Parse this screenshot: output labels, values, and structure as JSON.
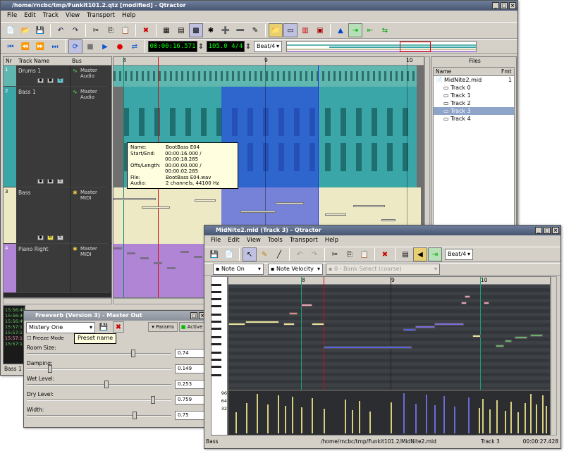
{
  "main": {
    "title": "/home/rncbc/tmp/Funkit101.2.qtz [modified] - Qtractor",
    "menu": [
      "File",
      "Edit",
      "Track",
      "View",
      "Transport",
      "Help"
    ],
    "time_display": "00:00:16.571",
    "tempo_display": "105.0 4/4",
    "snap": "Beat/4",
    "track_header": {
      "nr": "Nr",
      "name": "Track Name",
      "bus": "Bus"
    },
    "ruler": [
      "8",
      "9",
      "10"
    ],
    "tracks": [
      {
        "nr": "1",
        "name": "Drums 1",
        "bus": "Master",
        "bus_type": "Audio"
      },
      {
        "nr": "2",
        "name": "Bass 1",
        "bus": "Master",
        "bus_type": "Audio"
      },
      {
        "nr": "3",
        "name": "Bass",
        "bus": "Master",
        "bus_type": "MIDI"
      },
      {
        "nr": "4",
        "name": "Piano Right",
        "bus": "Master",
        "bus_type": "MIDI"
      }
    ],
    "clip_tooltip": [
      {
        "k": "Name:",
        "v": "BootBass E04"
      },
      {
        "k": "Start/End:",
        "v": "00:00:16.000 / 00:00:18.285"
      },
      {
        "k": "Offs/Length:",
        "v": "00:00:00.000 / 00:00:02.285"
      },
      {
        "k": "File:",
        "v": "BootBass E04.wav"
      },
      {
        "k": "Audio:",
        "v": "2 channels, 44100 Hz"
      }
    ],
    "messages": [
      "15:56:49",
      "15:56:49",
      "15:56:49",
      "15:57:11",
      "15:57:11",
      "15:57:13",
      "15:57:13"
    ],
    "status": "Bass 1",
    "files": {
      "title": "Files",
      "col_name": "Name",
      "col_fmt": "Fmt",
      "root": "MidNite2.mid",
      "root_fmt": "1",
      "items": [
        "Track 0",
        "Track 1",
        "Track 2",
        "Track 3",
        "Track 4"
      ],
      "selected": "Track 3"
    }
  },
  "freeverb": {
    "title": "Freeverb (Version 3) - Master Out",
    "preset": "Mistery One",
    "tooltip": "Preset name",
    "freeze": "Freeze Mode",
    "params_btn": "Params",
    "active_btn": "Active",
    "params": [
      {
        "label": "Room Size:",
        "value": "0.74",
        "level": 0.74
      },
      {
        "label": "Damping:",
        "value": "0.149",
        "level": 0.149
      },
      {
        "label": "Wet Level:",
        "value": "0.253",
        "level": 0.55
      },
      {
        "label": "Dry Level:",
        "value": "0.759",
        "level": 0.88
      },
      {
        "label": "Width:",
        "value": "0.75",
        "level": 0.75
      }
    ]
  },
  "midi": {
    "title": "MidNite2.mid (Track 3) - Qtractor",
    "menu": [
      "File",
      "Edit",
      "View",
      "Tools",
      "Transport",
      "Help"
    ],
    "snap": "Beat/4",
    "event_type": "Note On",
    "value_type": "Note Velocity",
    "controller": "0 - Bank Select (coarse)",
    "ruler": [
      "8",
      "9",
      "10"
    ],
    "velocity_ticks": [
      "96",
      "64",
      "32"
    ],
    "status": {
      "track": "Bass",
      "path": "/home/rncbc/tmp/Funkit101.2/MidNite2.mid",
      "trackno": "Track 3",
      "time": "00:00:27.428"
    }
  },
  "colors": {
    "track1": "#5fb7b0",
    "track2": "#3aa6a8",
    "track3": "#ece9c4",
    "track4": "#b085d6",
    "selection": "#3a4ee0",
    "playhead": "#d01010"
  }
}
